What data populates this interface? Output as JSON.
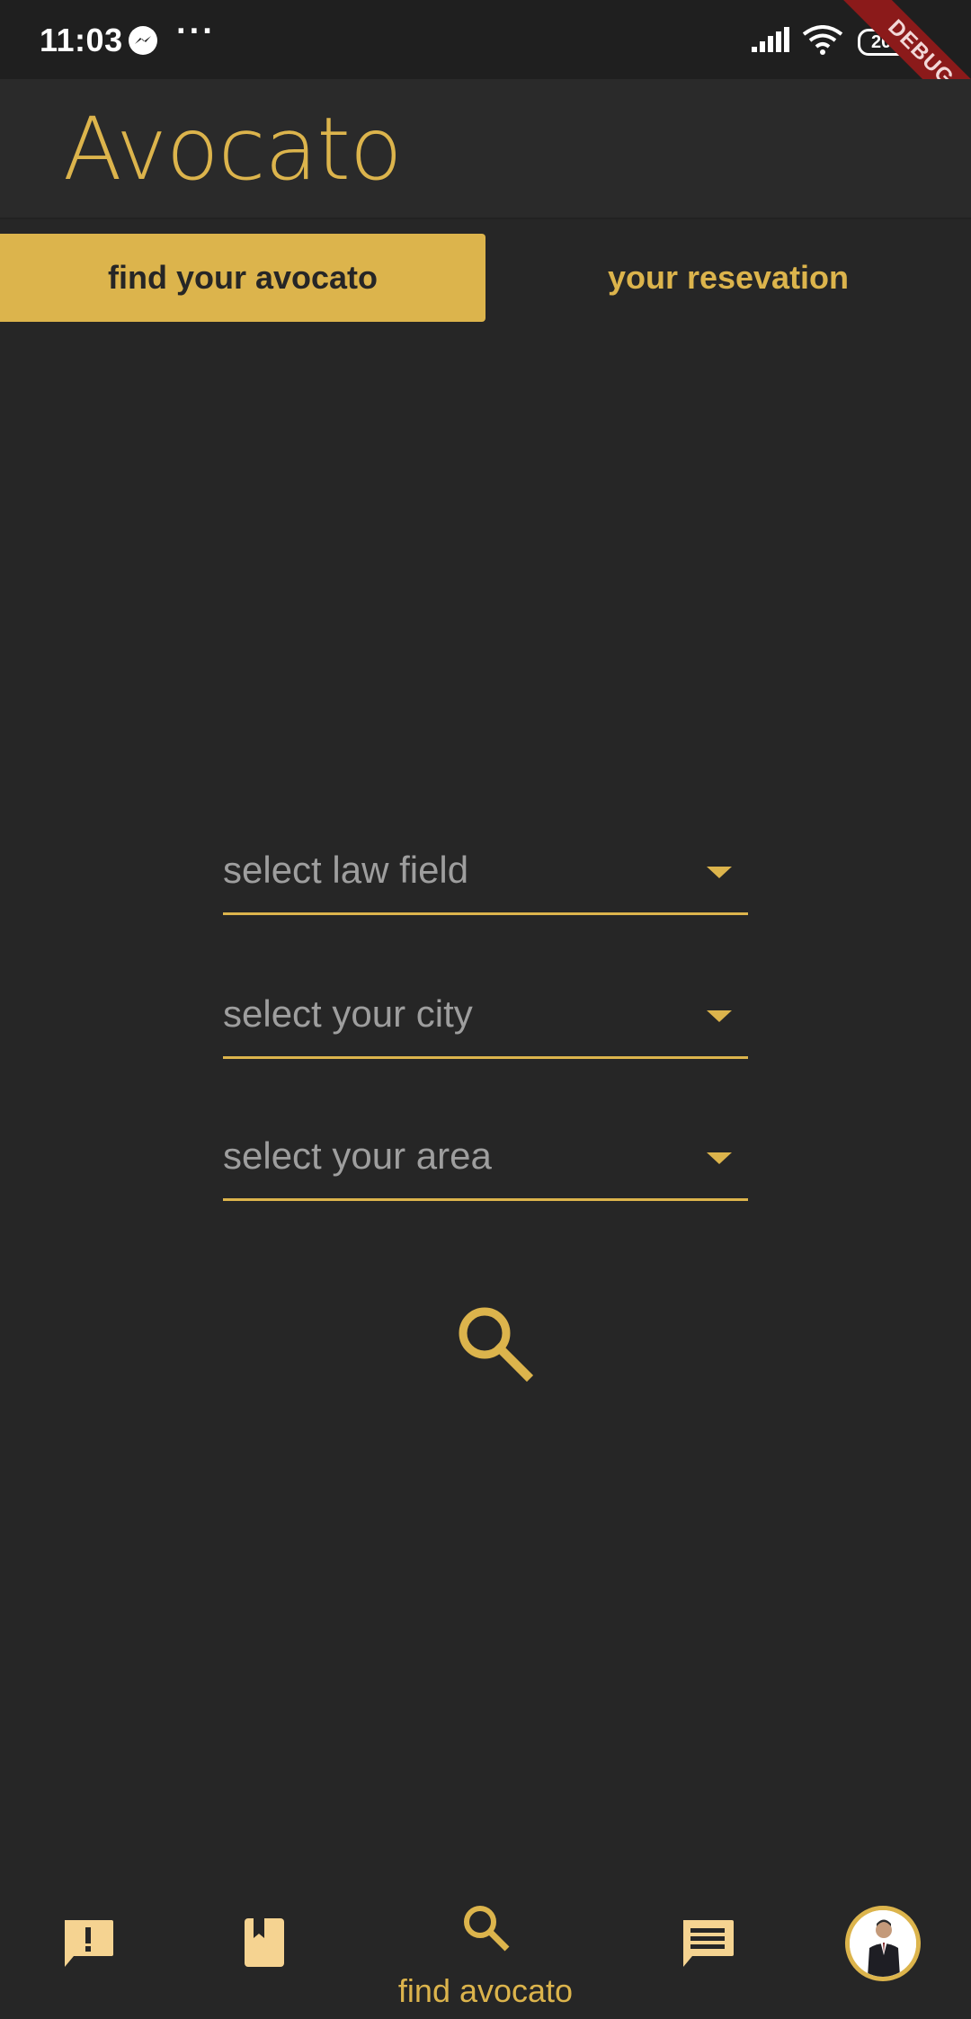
{
  "status_bar": {
    "time": "11:03",
    "more": "···",
    "battery": "20",
    "debug_banner": "DEBUG"
  },
  "app_bar": {
    "title": "Avocato"
  },
  "tabs": [
    {
      "label": "find your avocato",
      "active": true
    },
    {
      "label": "your resevation",
      "active": false
    }
  ],
  "form": {
    "law_field": {
      "placeholder": "select law field"
    },
    "city": {
      "placeholder": "select your city"
    },
    "area": {
      "placeholder": "select your area"
    }
  },
  "bottom_nav": {
    "items": [
      {
        "icon": "feedback-icon",
        "label": ""
      },
      {
        "icon": "book-icon",
        "label": ""
      },
      {
        "icon": "search-icon",
        "label": "find avocato",
        "selected": true
      },
      {
        "icon": "chat-icon",
        "label": ""
      },
      {
        "icon": "avatar",
        "label": ""
      }
    ]
  },
  "colors": {
    "accent": "#dcb44c",
    "background": "#262626",
    "app_bar": "#2a2a2a",
    "placeholder_text": "#9e9e9e",
    "debug_banner": "#8b1a1a"
  }
}
